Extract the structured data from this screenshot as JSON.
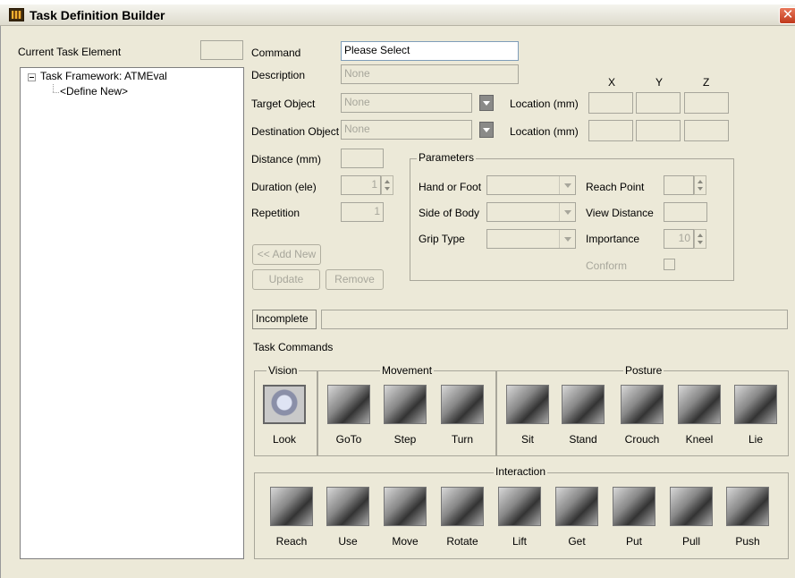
{
  "window": {
    "title": "Task Definition Builder",
    "close_glyph": "✕"
  },
  "left": {
    "header_label": "Current Task Element",
    "tree": {
      "root": "Task Framework: ATMEval",
      "child": "<Define New>"
    }
  },
  "form": {
    "command_label": "Command",
    "command_value": "Please Select",
    "description_label": "Description",
    "description_value": "None",
    "target_label": "Target Object",
    "target_value": "None",
    "destination_label": "Destination Object",
    "destination_value": "None",
    "location_label": "Location (mm)",
    "axis_x": "X",
    "axis_y": "Y",
    "axis_z": "Z",
    "distance_label": "Distance (mm)",
    "duration_label": "Duration (ele)",
    "duration_value": "1",
    "repetition_label": "Repetition",
    "repetition_value": "1",
    "add_new_label": "<< Add New",
    "update_label": "Update",
    "remove_label": "Remove"
  },
  "parameters": {
    "title": "Parameters",
    "hand_or_foot_label": "Hand or Foot",
    "side_of_body_label": "Side of Body",
    "grip_type_label": "Grip Type",
    "reach_point_label": "Reach Point",
    "view_distance_label": "View Distance",
    "importance_label": "Importance",
    "importance_value": "10",
    "conform_label": "Conform"
  },
  "status": {
    "text": "Incomplete",
    "message": ""
  },
  "task_commands": {
    "title": "Task Commands",
    "groups": {
      "vision": "Vision",
      "movement": "Movement",
      "posture": "Posture",
      "interaction": "Interaction"
    },
    "vision": [
      "Look"
    ],
    "movement": [
      "GoTo",
      "Step",
      "Turn"
    ],
    "posture": [
      "Sit",
      "Stand",
      "Crouch",
      "Kneel",
      "Lie"
    ],
    "interaction": [
      "Reach",
      "Use",
      "Move",
      "Rotate",
      "Lift",
      "Get",
      "Put",
      "Pull",
      "Push"
    ]
  }
}
